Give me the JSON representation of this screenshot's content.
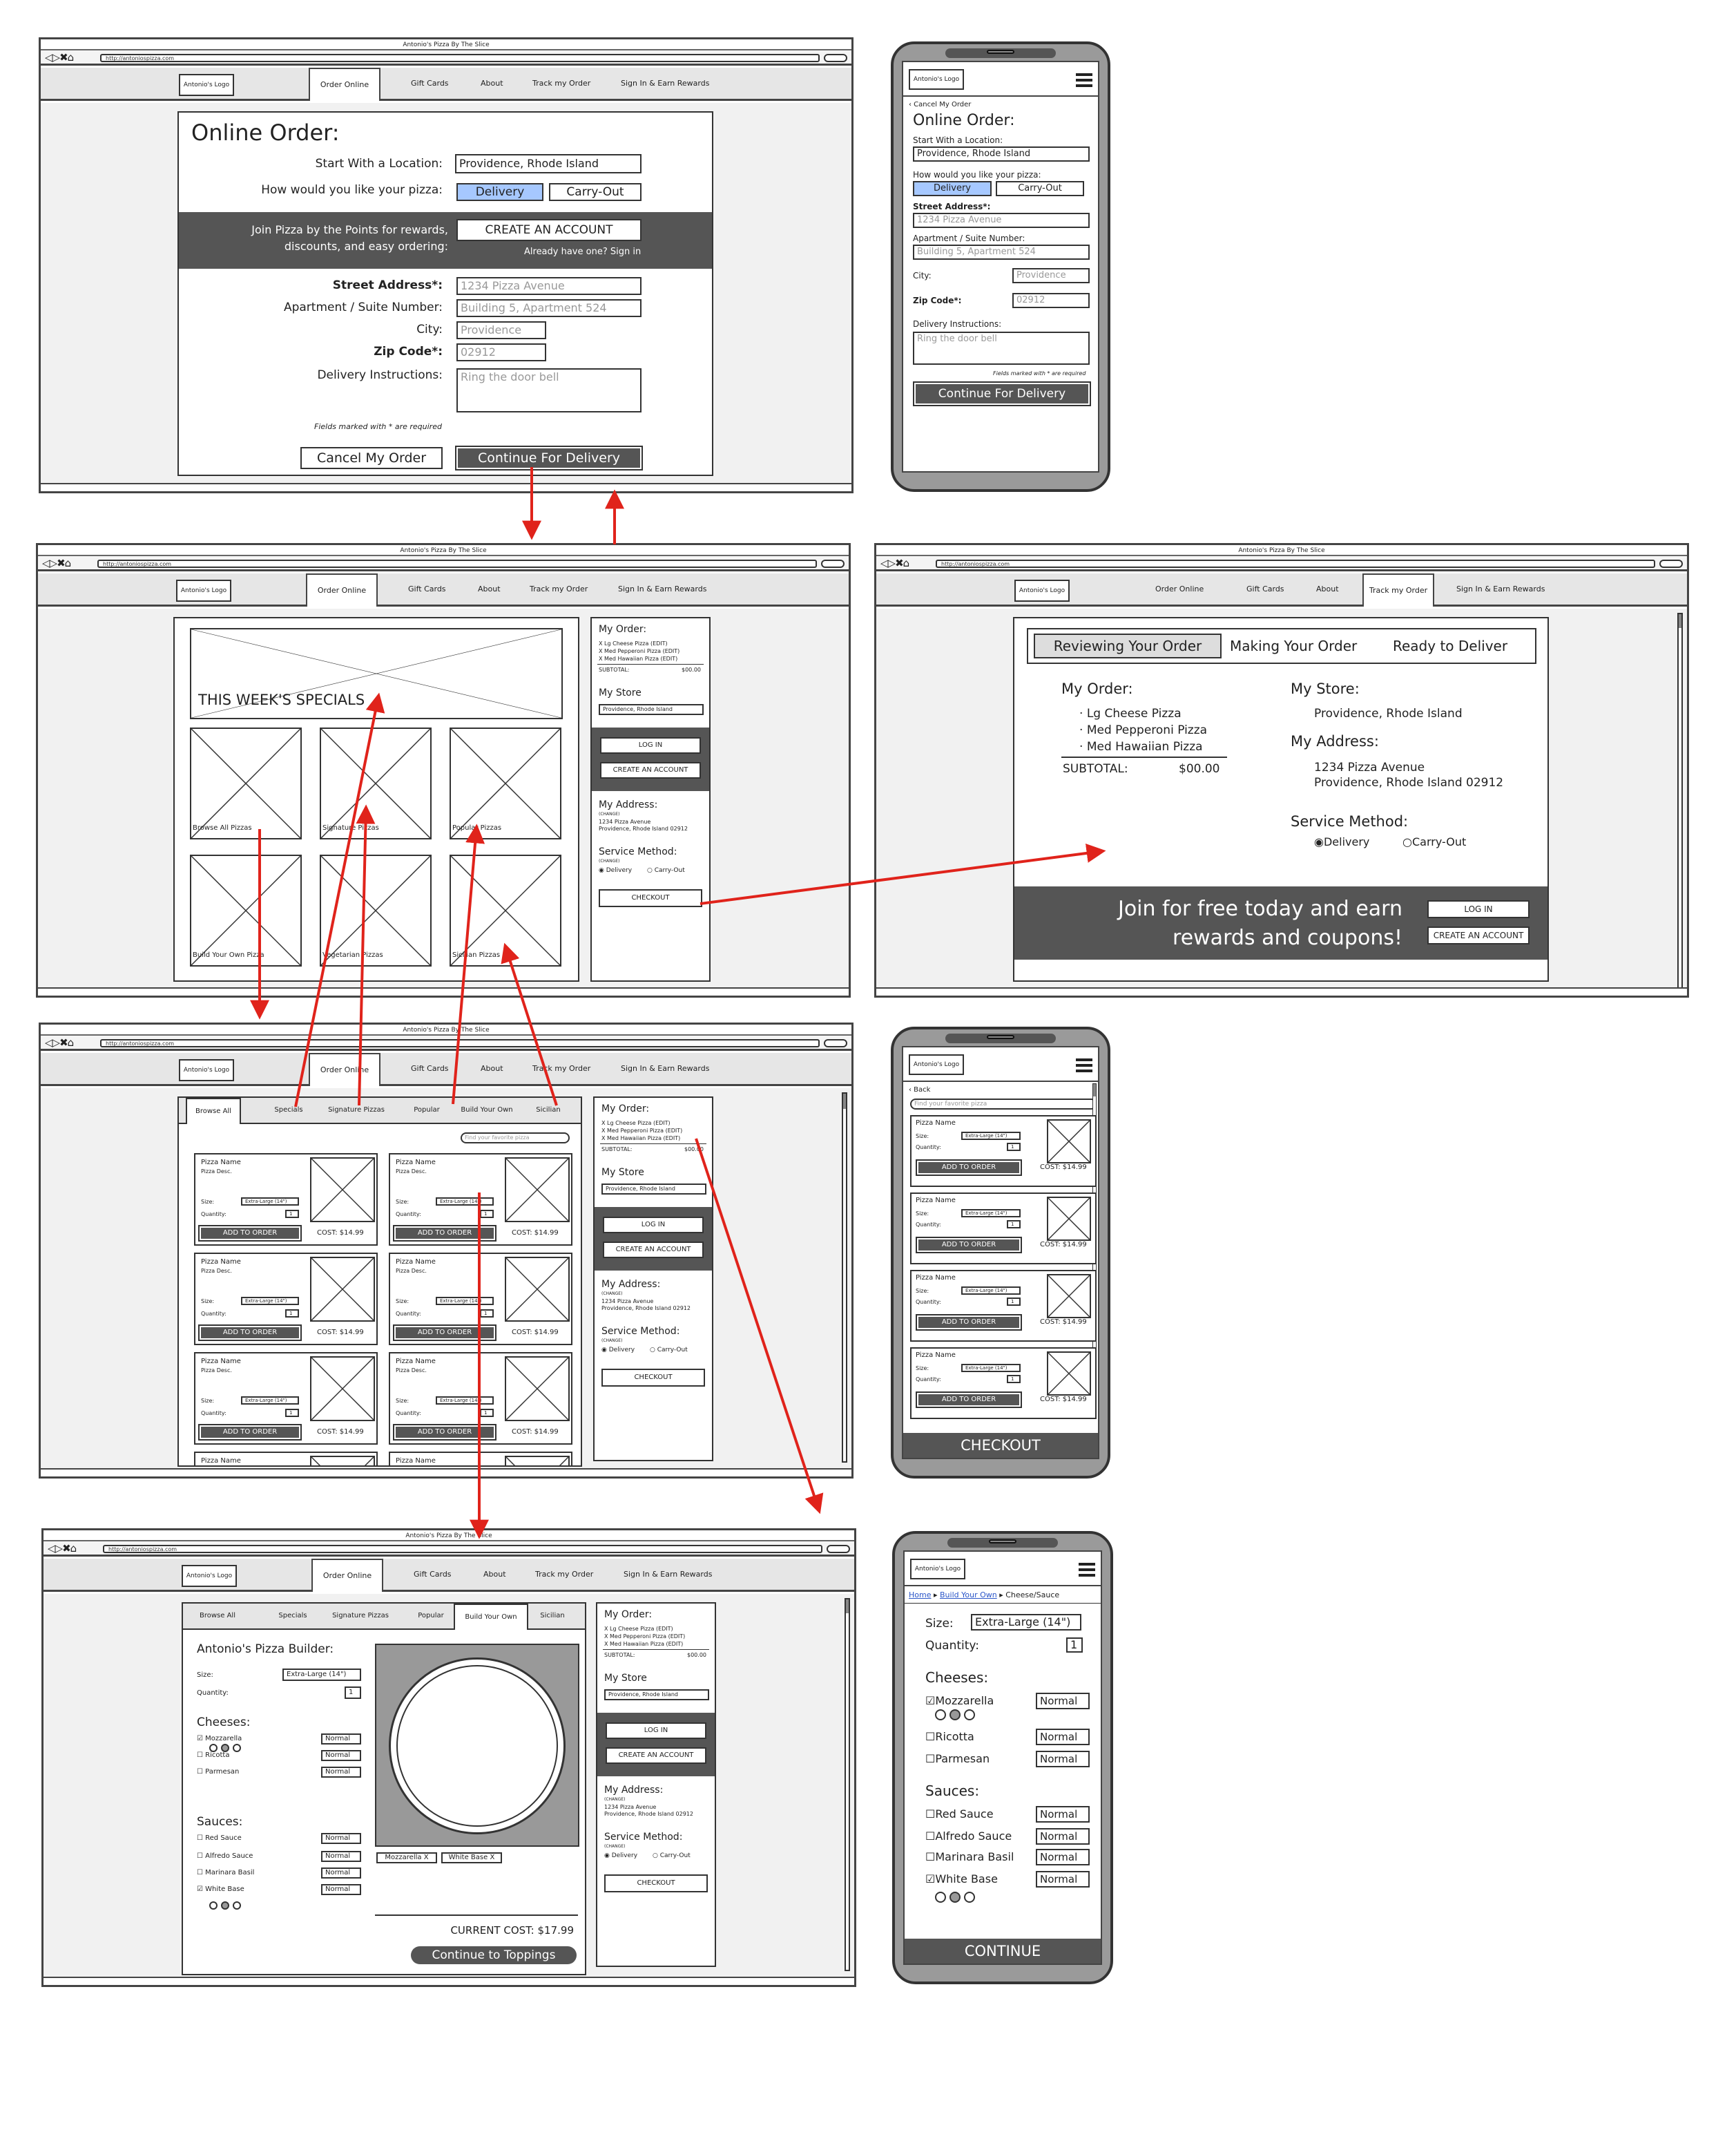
{
  "common": {
    "title": "Antonio's Pizza By The Slice",
    "url": "http://antoniospizza.com",
    "logo": "Antonio's Logo",
    "nav": [
      "Order Online",
      "Gift Cards",
      "About",
      "Track my Order",
      "Sign In & Earn Rewards"
    ]
  },
  "s1": {
    "heading": "Online Order:",
    "location_label": "Start With a Location:",
    "location_value": "Providence, Rhode Island",
    "howlike_label": "How would you like your pizza:",
    "delivery": "Delivery",
    "carryout": "Carry-Out",
    "join_text": "Join Pizza by the Points for rewards, discounts, and easy ordering:",
    "create_account": "CREATE AN ACCOUNT",
    "already": "Already have one? Sign in",
    "street_label": "Street Address*:",
    "street_ph": "1234 Pizza Avenue",
    "apt_label": "Apartment / Suite Number:",
    "apt_ph": "Building 5, Apartment 524",
    "city_label": "City:",
    "city_ph": "Providence",
    "zip_label": "Zip Code*:",
    "zip_ph": "02912",
    "instr_label": "Delivery Instructions:",
    "instr_ph": "Ring the door bell",
    "required_note": "Fields marked with * are required",
    "cancel": "Cancel My Order",
    "continue": "Continue For Delivery"
  },
  "m1": {
    "cancel": "‹ Cancel My Order",
    "heading": "Online Order:",
    "location_label": "Start With a Location:",
    "location_value": "Providence, Rhode Island",
    "howlike_label": "How would you like your pizza:",
    "delivery": "Delivery",
    "carryout": "Carry-Out",
    "street_label": "Street Address*:",
    "street_ph": "1234 Pizza Avenue",
    "apt_label": "Apartment / Suite Number:",
    "apt_ph": "Building 5, Apartment 524",
    "city_label": "City:",
    "city_ph": "Providence",
    "zip_label": "Zip Code*:",
    "zip_ph": "02912",
    "instr_label": "Delivery Instructions:",
    "instr_ph": "Ring the door bell",
    "required_note": "Fields marked with * are required",
    "continue": "Continue For Delivery"
  },
  "sidebar": {
    "my_order": "My Order:",
    "items": [
      "X Lg Cheese Pizza (EDIT)",
      "X Med Pepperoni Pizza (EDIT)",
      "X Med Hawaiian Pizza (EDIT)"
    ],
    "subtotal_label": "SUBTOTAL:",
    "subtotal": "$00.00",
    "my_store": "My Store",
    "store_value": "Providence, Rhode Island",
    "log_in": "LOG IN",
    "create": "CREATE AN ACCOUNT",
    "my_address": "My Address:",
    "change": "(CHANGE)",
    "addr1": "1234 Pizza Avenue",
    "addr2": "Providence, Rhode Island 02912",
    "service": "Service Method:",
    "delivery": "Delivery",
    "carryout": "Carry-Out",
    "checkout": "CHECKOUT"
  },
  "s2": {
    "specials": "THIS WEEK'S SPECIALS",
    "tiles": [
      "Browse All Pizzas",
      "Signature Pizzas",
      "Popular Pizzas",
      "Build Your Own Pizza",
      "Vegetarian Pizzas",
      "Sicilian Pizzas"
    ]
  },
  "s3": {
    "steps": [
      "Reviewing Your Order",
      "Making Your Order",
      "Ready to Deliver"
    ],
    "my_order": "My Order:",
    "items": [
      "Lg Cheese Pizza",
      "Med Pepperoni Pizza",
      "Med Hawaiian Pizza"
    ],
    "subtotal_label": "SUBTOTAL:",
    "subtotal": "$00.00",
    "my_store": "My Store:",
    "store": "Providence, Rhode Island",
    "my_address": "My Address:",
    "addr1": "1234 Pizza Avenue",
    "addr2": "Providence, Rhode Island 02912",
    "service": "Service Method:",
    "delivery": "Delivery",
    "carryout": "Carry-Out",
    "join": "Join for free today and earn rewards and coupons!",
    "log_in": "LOG IN",
    "create": "CREATE AN ACCOUNT"
  },
  "s4": {
    "tabs": [
      "Browse All",
      "Specials",
      "Signature Pizzas",
      "Popular",
      "Build Your Own",
      "Sicilian"
    ],
    "search_ph": "Find your favorite pizza",
    "card": {
      "name": "Pizza Name",
      "desc": "Pizza Desc.",
      "size": "Size:",
      "size_val": "Extra-Large (14\")",
      "qty": "Quantity:",
      "qty_val": "1",
      "add": "ADD TO ORDER",
      "cost": "COST: $14.99"
    }
  },
  "m4": {
    "back": "‹ Back",
    "search_ph": "Find your favorite pizza",
    "checkout": "CHECKOUT"
  },
  "s5": {
    "tabs": [
      "Browse All",
      "Specials",
      "Signature Pizzas",
      "Popular",
      "Build Your Own",
      "Sicilian"
    ],
    "heading": "Antonio's Pizza Builder:",
    "size": "Size:",
    "size_val": "Extra-Large (14\")",
    "qty": "Quantity:",
    "qty_val": "1",
    "cheeses": "Cheeses:",
    "cheese_items": [
      "Mozzarella",
      "Ricotta",
      "Parmesan"
    ],
    "sauces": "Sauces:",
    "sauce_items": [
      "Red Sauce",
      "Alfredo Sauce",
      "Marinara Basil",
      "White Base"
    ],
    "normal": "Normal",
    "tags": [
      "Mozzarella X",
      "White Base X"
    ],
    "current_cost": "CURRENT COST: $17.99",
    "continue": "Continue to Toppings"
  },
  "m5": {
    "crumb_home": "Home",
    "crumb_byo": "Build Your Own",
    "crumb_cur": "Cheese/Sauce",
    "size": "Size:",
    "size_val": "Extra-Large (14\")",
    "qty": "Quantity:",
    "qty_val": "1",
    "cheeses": "Cheeses:",
    "cheese_items": [
      "Mozzarella",
      "Ricotta",
      "Parmesan"
    ],
    "sauces": "Sauces:",
    "sauce_items": [
      "Red Sauce",
      "Alfredo Sauce",
      "Marinara Basil",
      "White Base"
    ],
    "normal": "Normal",
    "continue": "CONTINUE"
  }
}
